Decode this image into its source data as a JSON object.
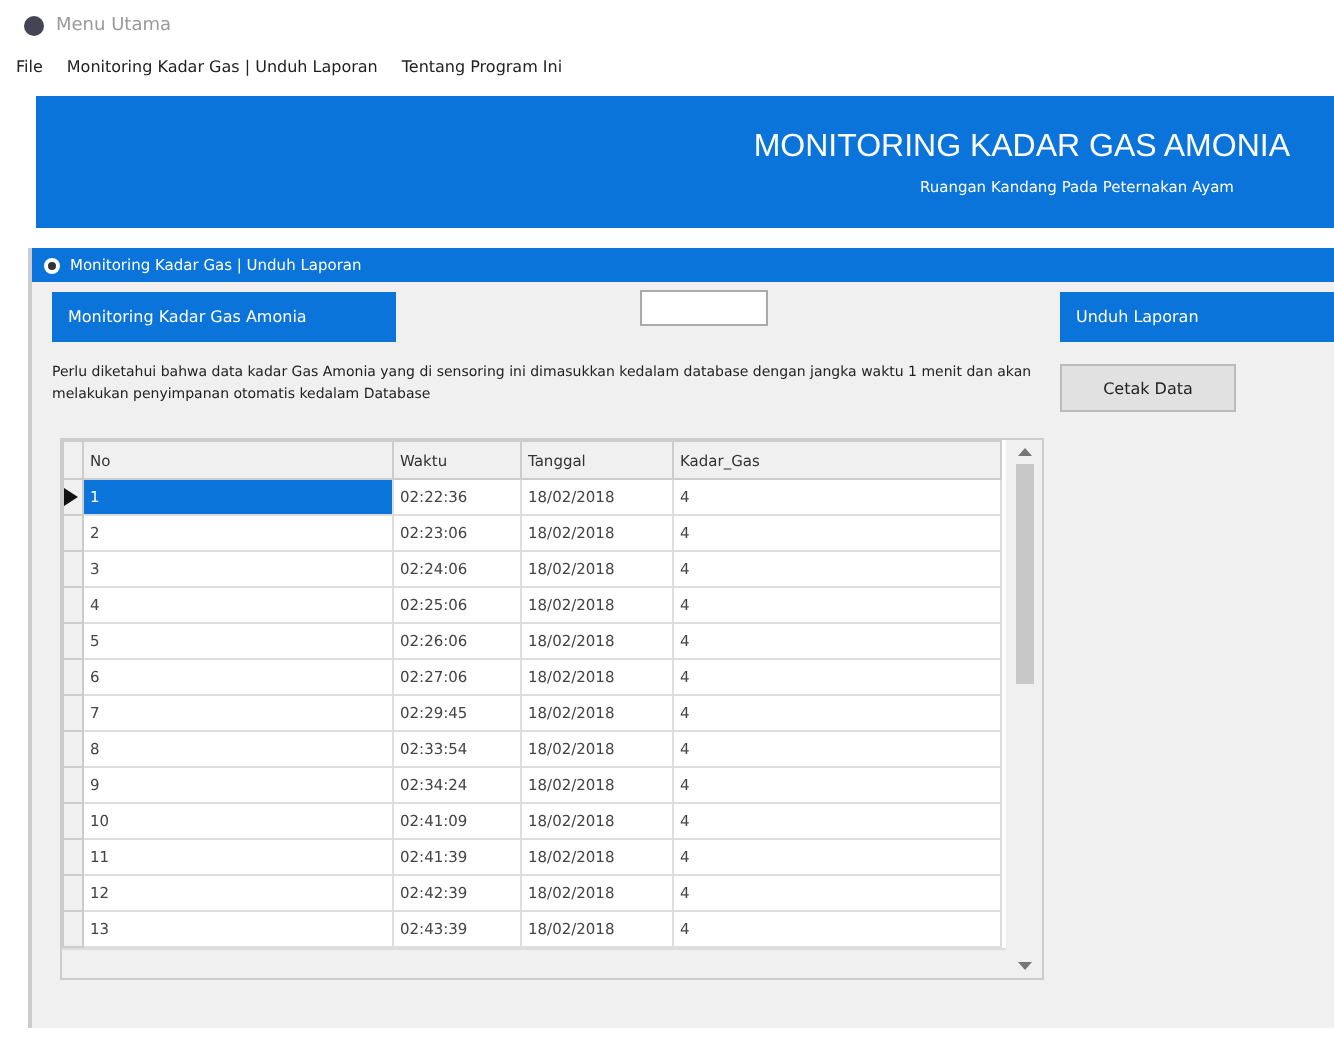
{
  "window": {
    "title": "Menu Utama"
  },
  "menu": [
    "File",
    "Monitoring Kadar Gas | Unduh Laporan",
    "Tentang Program Ini"
  ],
  "header": {
    "title": "MONITORING KADAR GAS AMONIA",
    "subtitle": "Ruangan Kandang Pada Peternakan Ayam"
  },
  "group": {
    "title": "Monitoring Kadar Gas | Unduh Laporan",
    "selected": true
  },
  "buttons": {
    "monitoring": "Monitoring Kadar Gas Amonia",
    "download": "Unduh Laporan",
    "print": "Cetak Data"
  },
  "note": "Perlu diketahui bahwa data kadar Gas Amonia yang di sensoring ini dimasukkan kedalam database dengan jangka waktu 1 menit dan akan melakukan penyimpanan otomatis kedalam Database",
  "table": {
    "columns": [
      "No",
      "Waktu",
      "Tanggal",
      "Kadar_Gas"
    ],
    "rows": [
      {
        "cells": [
          "1",
          "02:22:36",
          "18/02/2018",
          "4"
        ],
        "selected": true
      },
      {
        "cells": [
          "2",
          "02:23:06",
          "18/02/2018",
          "4"
        ],
        "selected": false
      },
      {
        "cells": [
          "3",
          "02:24:06",
          "18/02/2018",
          "4"
        ],
        "selected": false
      },
      {
        "cells": [
          "4",
          "02:25:06",
          "18/02/2018",
          "4"
        ],
        "selected": false
      },
      {
        "cells": [
          "5",
          "02:26:06",
          "18/02/2018",
          "4"
        ],
        "selected": false
      },
      {
        "cells": [
          "6",
          "02:27:06",
          "18/02/2018",
          "4"
        ],
        "selected": false
      },
      {
        "cells": [
          "7",
          "02:29:45",
          "18/02/2018",
          "4"
        ],
        "selected": false
      },
      {
        "cells": [
          "8",
          "02:33:54",
          "18/02/2018",
          "4"
        ],
        "selected": false
      },
      {
        "cells": [
          "9",
          "02:34:24",
          "18/02/2018",
          "4"
        ],
        "selected": false
      },
      {
        "cells": [
          "10",
          "02:41:09",
          "18/02/2018",
          "4"
        ],
        "selected": false
      },
      {
        "cells": [
          "11",
          "02:41:39",
          "18/02/2018",
          "4"
        ],
        "selected": false
      },
      {
        "cells": [
          "12",
          "02:42:39",
          "18/02/2018",
          "4"
        ],
        "selected": false
      },
      {
        "cells": [
          "13",
          "02:43:39",
          "18/02/2018",
          "4"
        ],
        "selected": false
      }
    ]
  }
}
